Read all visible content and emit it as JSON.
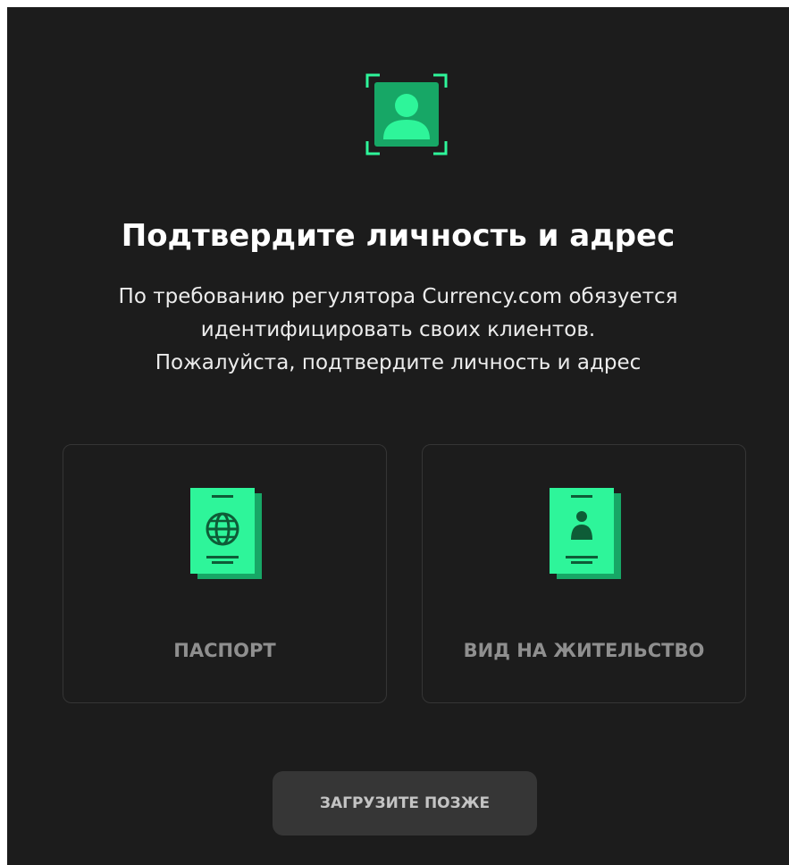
{
  "header": {
    "icon": "face-id-icon",
    "title": "Подтвердите личность и адрес"
  },
  "description": {
    "line1": "По требованию регулятора Currency.com обязуется",
    "line2": "идентифицировать своих клиентов.",
    "line3": "Пожалуйста, подтвердите личность и адрес"
  },
  "options": [
    {
      "label": "ПАСПОРТ",
      "icon": "passport-icon"
    },
    {
      "label": "ВИД НА ЖИТЕЛЬСТВО",
      "icon": "residence-permit-icon"
    }
  ],
  "later_button": {
    "label": "ЗАГРУЗИТЕ ПОЗЖЕ"
  },
  "colors": {
    "background": "#1c1c1c",
    "accent": "#2ef59a",
    "accent_dark": "#17a766",
    "card_border": "#353535",
    "button_bg": "#363636"
  }
}
